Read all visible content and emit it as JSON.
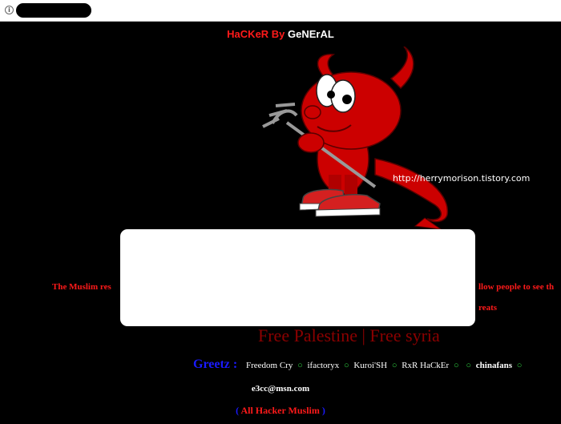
{
  "browser": {
    "info_icon_glyph": "i",
    "url_value": "",
    "url_redacted": true
  },
  "header": {
    "title_part1": "HaCKeR By ",
    "title_part2": "GeNErAL"
  },
  "mascot": {
    "icon": "red-devil-mascot-icon"
  },
  "site_link": "http://herrymorison.tistory.com",
  "messages": {
    "left_fragment": "The Muslim res",
    "right_fragment_1": "llow people to see th",
    "right_fragment_2": "reats"
  },
  "free_line": "Free Palestine | Free syria",
  "greetz": {
    "label": "Greetz :",
    "sep": "○",
    "names": [
      "Freedom Cry",
      "ifactoryx",
      "Kuroi'SH",
      "RxR HaCkEr",
      "",
      "chinafans"
    ]
  },
  "email": "e3cc@msn.com",
  "footer": {
    "open": "(",
    "text": " All Hacker Muslim ",
    "close": ")"
  },
  "colors": {
    "background": "#000000",
    "accent_red": "#ff1a1a",
    "greetz_blue": "#1a1aff",
    "separator_green": "#2ecc40",
    "dark_red": "#8b0000"
  }
}
